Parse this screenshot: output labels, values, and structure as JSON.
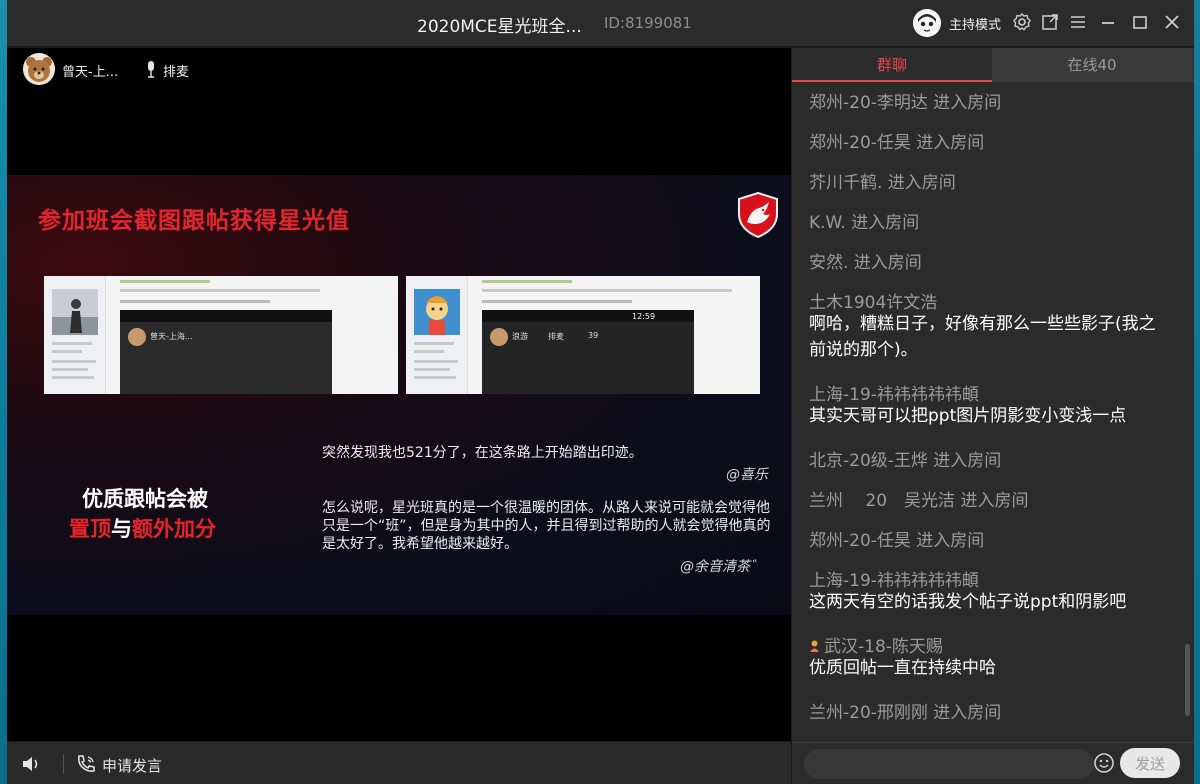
{
  "titlebar": {
    "title": "2020MCE星光班全...",
    "room_id": "ID:8199081",
    "mode_label": "主持模式"
  },
  "stage": {
    "speaker_name": "曾天-上...",
    "queue_label": "排麦",
    "slide": {
      "title": "参加班会截图跟帖获得星光值",
      "promo_line1": "优质跟帖会被",
      "promo_red1": "置顶",
      "promo_mid": "与",
      "promo_red2": "额外加分",
      "quote1": "突然发现我也521分了，在这条路上开始踏出印迹。",
      "sig1": "@喜乐",
      "quote2": "怎么说呢，星光班真的是一个很温暖的团体。从路人来说可能就会觉得他只是一个“班”，但是身为其中的人，并且得到过帮助的人就会觉得他真的是太好了。我希望他越来越好。",
      "sig2": "@余音清茶゛",
      "shot1_phone_text": "曾天-上海...",
      "shot2_phone_name": "浪游",
      "shot2_phone_queue": "排麦",
      "shot2_phone_count": "39",
      "shot2_time": "12:59"
    }
  },
  "bottombar": {
    "apply_label": "申请发言"
  },
  "panel": {
    "tab_chat": "群聊",
    "tab_online": "在线40",
    "messages": [
      {
        "name": "郑州-20-李明达 进入房间"
      },
      {
        "name": "郑州-20-任昊 进入房间"
      },
      {
        "name": "芥川千鹤. 进入房间"
      },
      {
        "name": "K.W. 进入房间"
      },
      {
        "name": "安然. 进入房间"
      },
      {
        "name": "土木1904许文浩",
        "text": "啊哈，糟糕日子，好像有那么一些些影子(我之前说的那个)。"
      },
      {
        "name": "上海-19-祎祎祎祎祎頔",
        "text": "其实天哥可以把ppt图片阴影变小变浅一点"
      },
      {
        "name": "北京-20级-王烨 进入房间"
      },
      {
        "name": "兰州　 20　吴光洁 进入房间"
      },
      {
        "name": "郑州-20-任昊 进入房间"
      },
      {
        "name": "上海-19-祎祎祎祎祎頔",
        "text": "这两天有空的话我发个帖子说ppt和阴影吧"
      },
      {
        "name": "武汉-18-陈天赐",
        "text": "优质回帖一直在持续中哈"
      },
      {
        "name": "兰州-20-邢刚刚 进入房间"
      }
    ],
    "send_label": "发送"
  }
}
